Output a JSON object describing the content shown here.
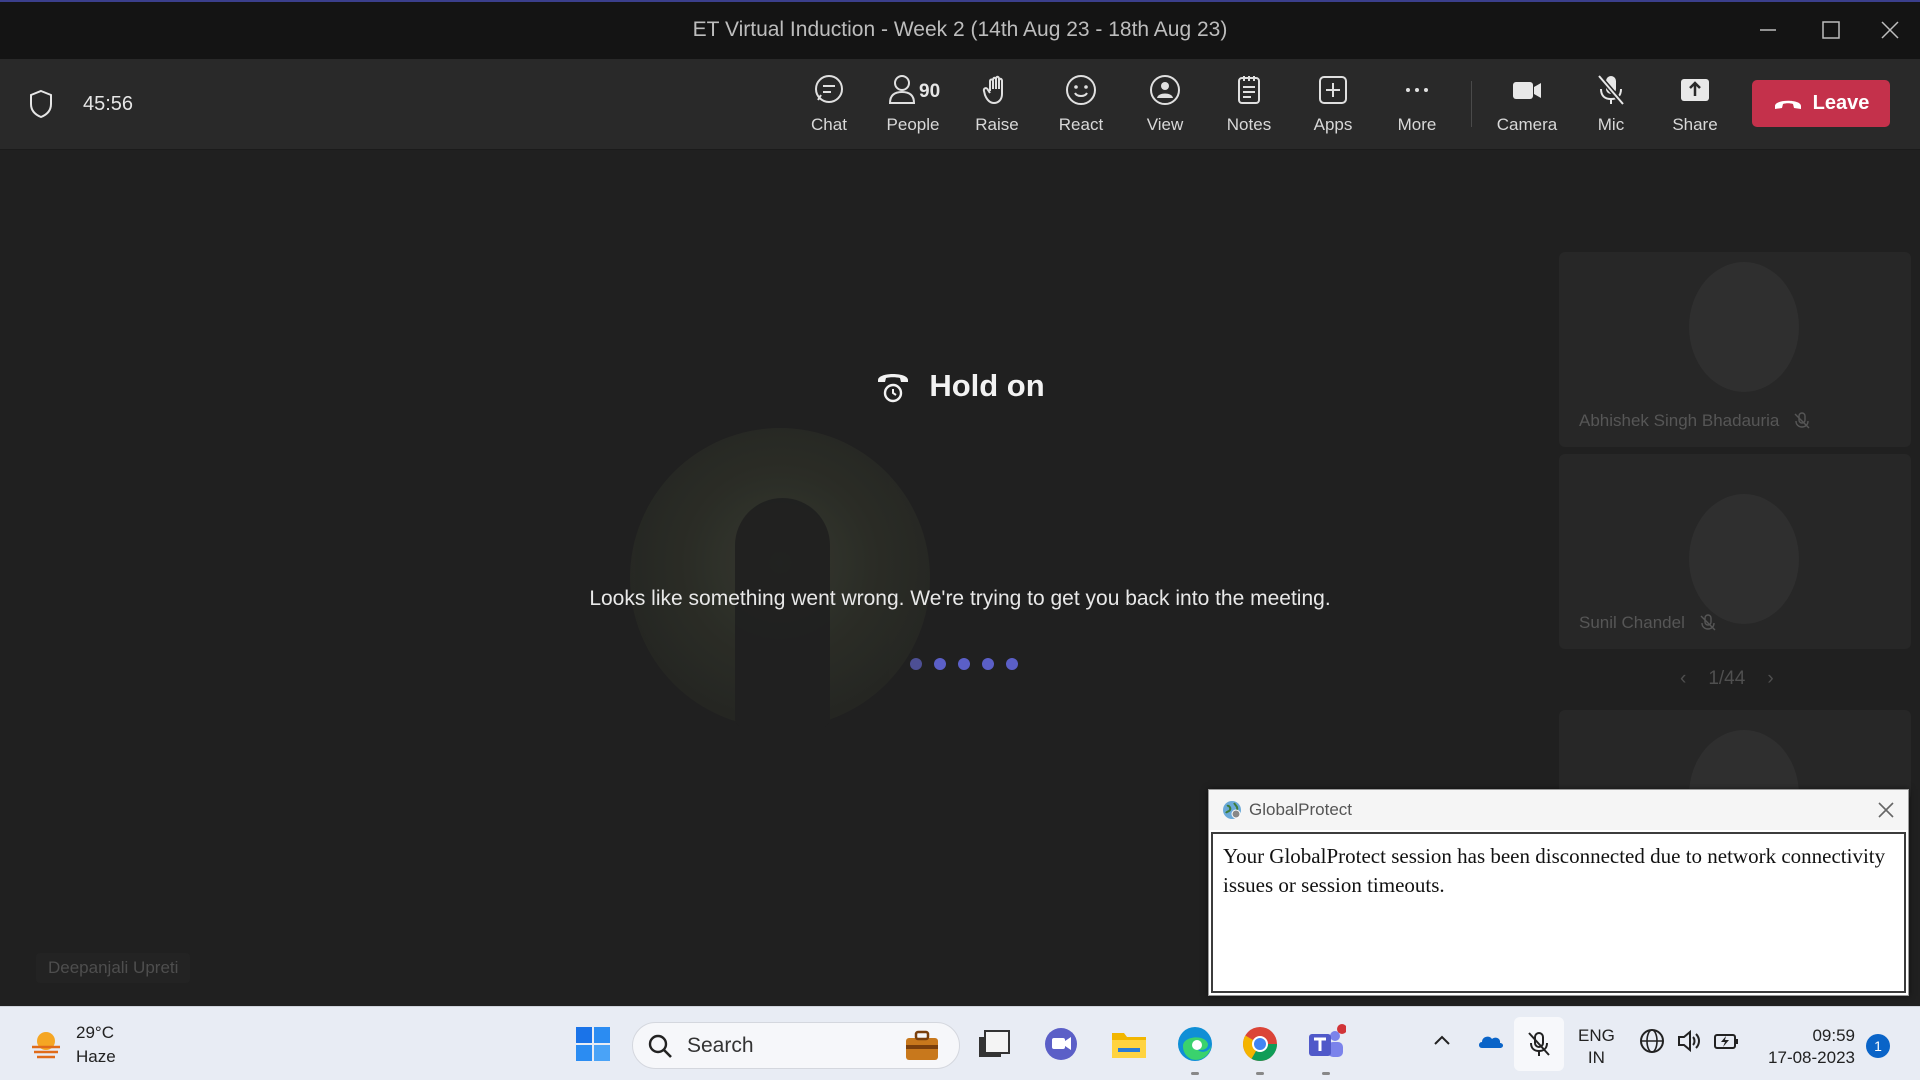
{
  "window": {
    "title": "ET Virtual Induction - Week 2 (14th Aug 23 - 18th Aug 23)"
  },
  "meeting": {
    "timer": "45:56",
    "people_count": "90",
    "toolbar": {
      "chat": "Chat",
      "people": "People",
      "raise": "Raise",
      "react": "React",
      "view": "View",
      "notes": "Notes",
      "apps": "Apps",
      "more": "More",
      "camera": "Camera",
      "mic": "Mic",
      "share": "Share",
      "leave": "Leave"
    },
    "hold": {
      "title": "Hold on",
      "message": "Looks like something went wrong. We're trying to get you back into the meeting."
    },
    "presenter_name": "Deepanjali Upreti",
    "participants": [
      {
        "name": "Abhishek Singh Bhadauria"
      },
      {
        "name": "Sunil Chandel"
      }
    ],
    "pager": "1/44"
  },
  "dialog": {
    "title": "GlobalProtect",
    "message": "Your GlobalProtect session has been disconnected due to network connectivity issues or session timeouts."
  },
  "taskbar": {
    "weather": {
      "temp": "29°C",
      "condition": "Haze"
    },
    "search_label": "Search",
    "lang_line1": "ENG",
    "lang_line2": "IN",
    "time": "09:59",
    "date": "17-08-2023",
    "notification_count": "1"
  },
  "colors": {
    "leave": "#c4314b",
    "accent": "#5b5fc7",
    "toolbar_bg": "#292929",
    "taskbar_bg": "#e8ecf4"
  }
}
